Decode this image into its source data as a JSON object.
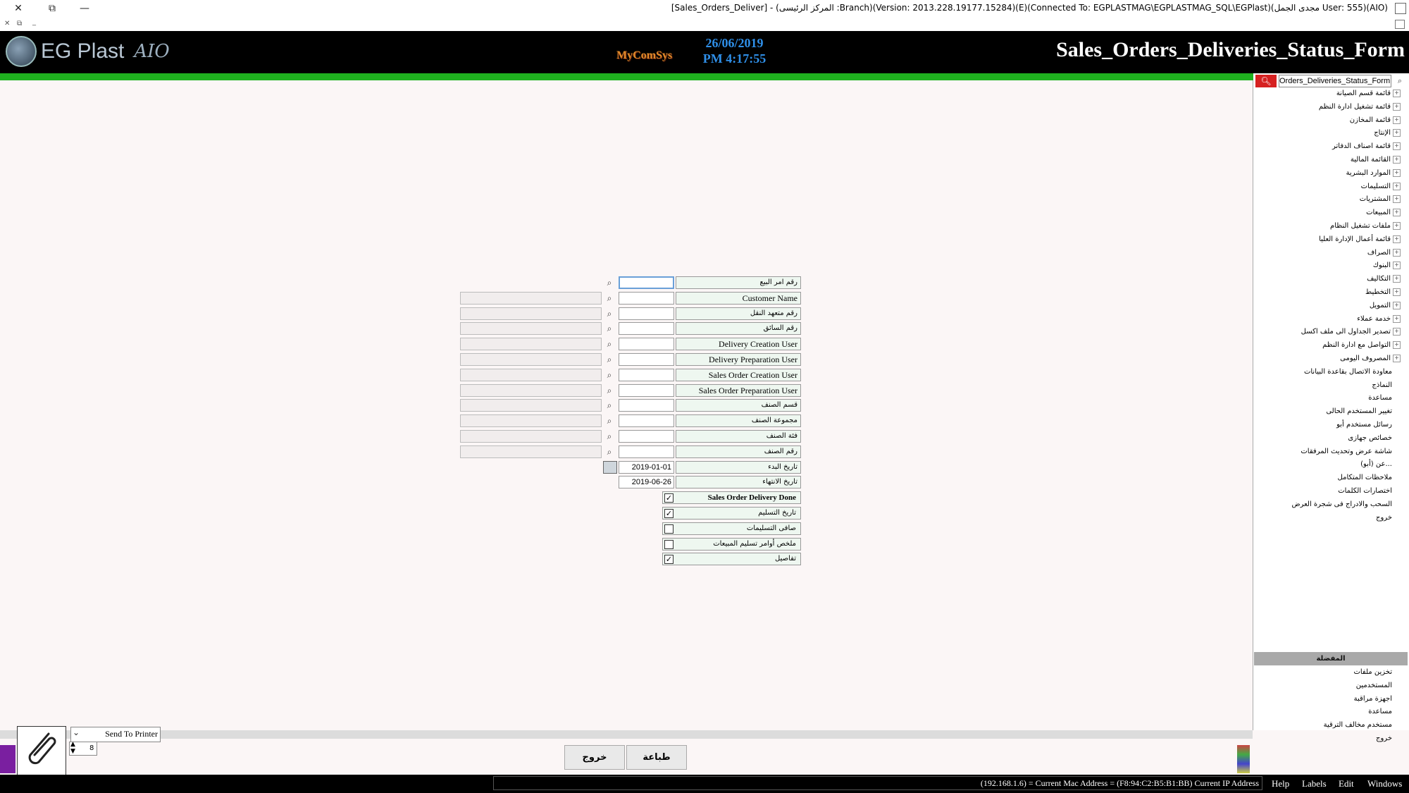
{
  "window": {
    "title": "[Sales_Orders_Deliver] - (المركز الرئيسى :Branch)(Version: 2013.228.19177.15284)(E)(Connected To: EGPLASTMAG\\EGPLASTMAG_SQL\\EGPlast)(مجدى الجمل User: 555)(AIO)",
    "close": "✕",
    "restore": "⧉",
    "minimize": "—"
  },
  "header": {
    "logo_text": "EG Plast",
    "logo_aio": "AIO",
    "brand": "MyComSys",
    "date": "26/06/2019",
    "time": "PM 4:17:55",
    "form_title": "Sales_Orders_Deliveries_Status_Form"
  },
  "form": {
    "rows": [
      {
        "label": "رقم امر البيع",
        "code": "",
        "has_name": false
      },
      {
        "label": "Customer Name",
        "code": "",
        "has_name": true
      },
      {
        "label": "رقم متعهد النقل",
        "code": "",
        "has_name": true
      },
      {
        "label": "رقم السائق",
        "code": "",
        "has_name": true
      },
      {
        "label": "Delivery Creation User",
        "code": "",
        "has_name": true
      },
      {
        "label": "Delivery Preparation User",
        "code": "",
        "has_name": true
      },
      {
        "label": "Sales Order Creation User",
        "code": "",
        "has_name": true
      },
      {
        "label": "Sales Order Preparation User",
        "code": "",
        "has_name": true
      },
      {
        "label": "قسم الصنف",
        "code": "",
        "has_name": true
      },
      {
        "label": "مجموعة الصنف",
        "code": "",
        "has_name": true
      },
      {
        "label": "فئة الصنف",
        "code": "",
        "has_name": true
      },
      {
        "label": "رقم الصنف",
        "code": "",
        "has_name": true
      }
    ],
    "start_date_label": "تاريخ البدء",
    "start_date": "2019-01-01",
    "end_date_label": "تاريخ الانتهاء",
    "end_date": "2019-06-26",
    "checks": [
      {
        "label": "Sales Order Delivery Done",
        "checked": true
      },
      {
        "label": "تاريخ التسليم",
        "checked": true
      },
      {
        "label": "صافى التسليمات",
        "checked": false
      },
      {
        "label": "ملخص أوامر تسليم المبيعات",
        "checked": false
      },
      {
        "label": "تفاصيل",
        "checked": true
      }
    ]
  },
  "sidebar": {
    "search_value": "Orders_Deliveries_Status_Form",
    "tree": [
      "قائمة قسم الصيانة",
      "قائمة تشغيل ادارة النظم",
      "قائمة المخازن",
      "الإنتاج",
      "قائمة اصناف الدفاتر",
      "القائمة المالية",
      "الموارد البشرية",
      "التسليمات",
      "المشتريات",
      "المبيعات",
      "ملفات تشغيل النظام",
      "قائمة أعمال الإدارة العليا",
      "الصراف",
      "البنوك",
      "التكاليف",
      "التخطيط",
      "التمويل",
      "خدمة عملاء",
      "تصدير الجداول الى ملف اكسل",
      "التواصل مع ادارة النظم",
      "المصروف اليومى"
    ],
    "tree_plain": [
      "معاودة الاتصال بقاعدة البيانات",
      "النماذج",
      "مساعدة",
      "تغيير المستخدم الحالى",
      "رسائل مستخدم أبو",
      "خصائص جهازى",
      "شاشة عرض وتحديث المرفقات",
      "عن (أبو)...",
      "ملاحظات المتكامل",
      "اختصارات الكلمات",
      "السحب والادراج فى شجرة العرض",
      "خروج"
    ],
    "section_title": "المفضلة",
    "favorites": [
      "تخزين ملفات",
      "المستخدمين",
      "اجهزة مراقبة",
      "مساعدة",
      "مستخدم مخالف الترقية",
      "خروج"
    ]
  },
  "bottom": {
    "printer": "Send To Printer",
    "copies": "8",
    "print_button": "طباعة",
    "exit_button": "خروج"
  },
  "status": {
    "address": "(192.168.1.6) = Current Mac Address = (F8:94:C2:B5:B1:BB) Current IP Address",
    "menu": [
      "Help",
      "Labels",
      "Edit",
      "Windows"
    ]
  }
}
